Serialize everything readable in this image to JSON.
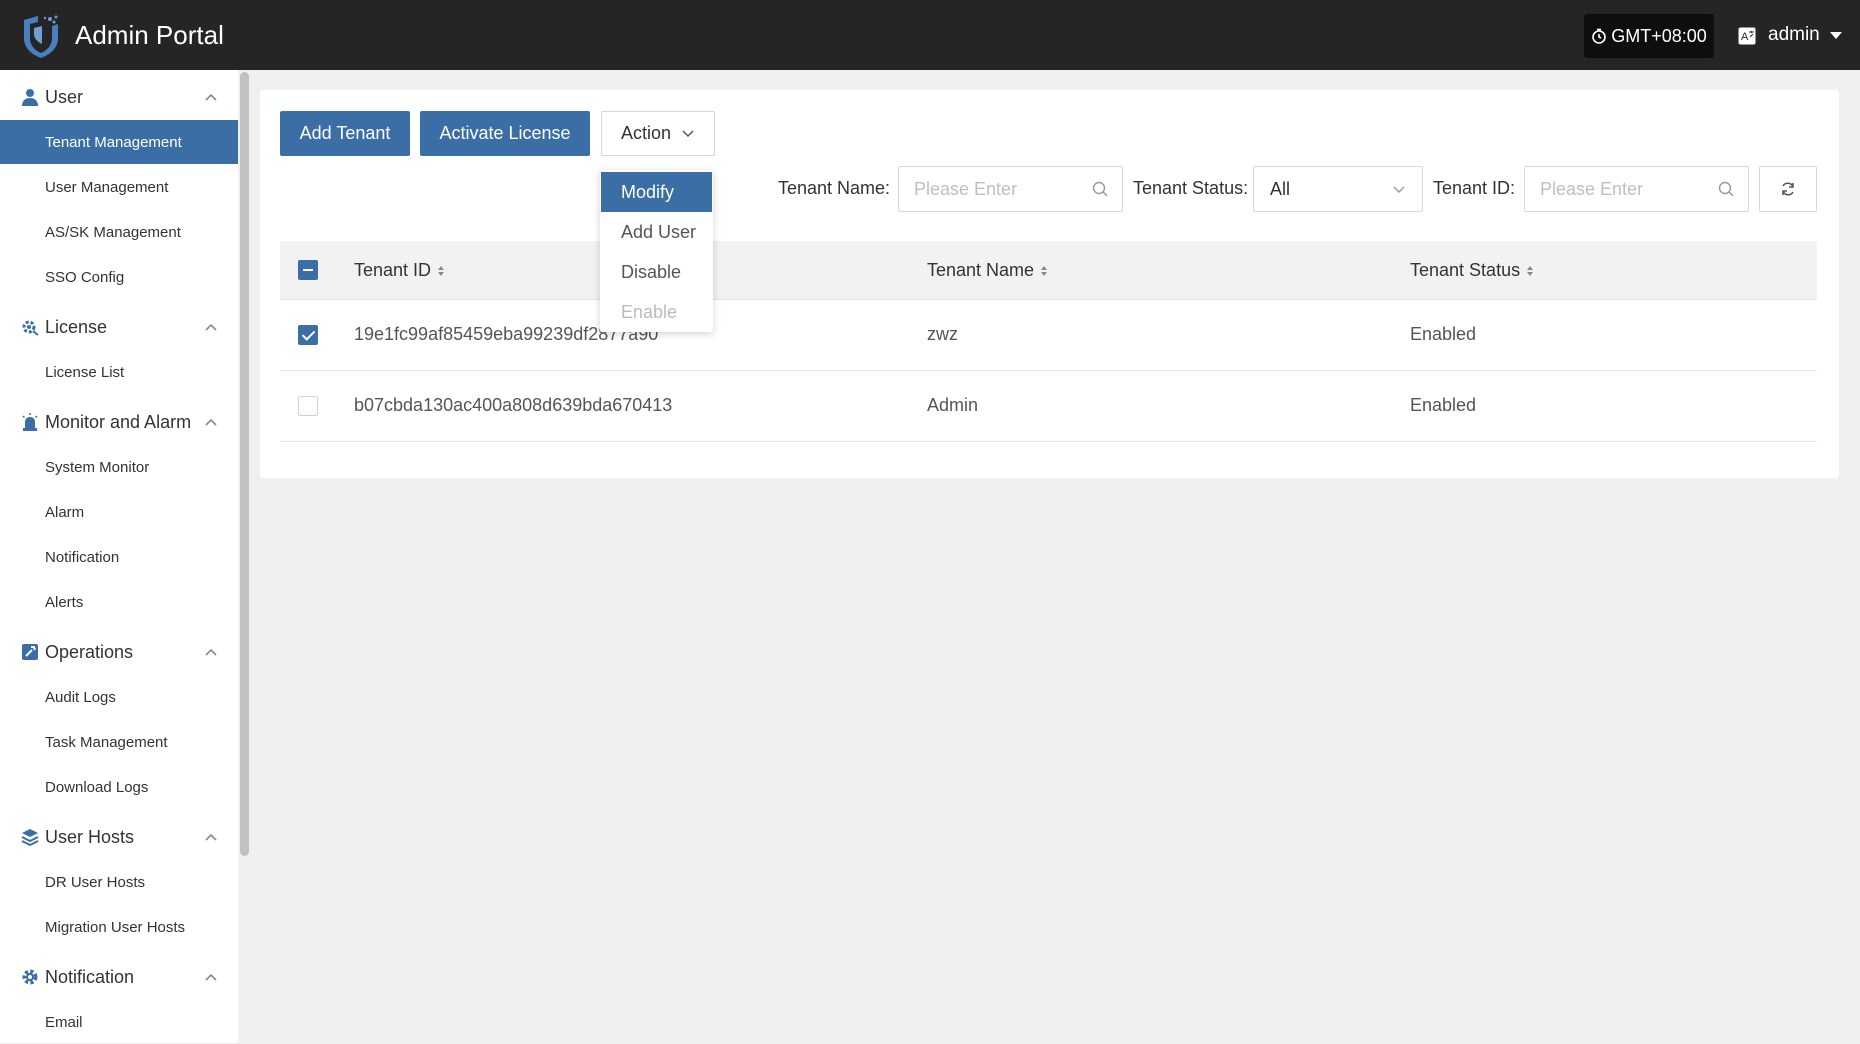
{
  "app": {
    "title": "Admin Portal"
  },
  "header": {
    "timezone": "GMT+08:00",
    "user": "admin"
  },
  "sidebar": {
    "groups": [
      {
        "label": "User",
        "icon": "user-icon",
        "items": [
          "Tenant Management",
          "User Management",
          "AS/SK Management",
          "SSO Config"
        ]
      },
      {
        "label": "License",
        "icon": "license-gear-icon",
        "items": [
          "License List"
        ]
      },
      {
        "label": "Monitor and Alarm",
        "icon": "alarm-siren-icon",
        "items": [
          "System Monitor",
          "Alarm",
          "Notification",
          "Alerts"
        ]
      },
      {
        "label": "Operations",
        "icon": "operations-wrench-icon",
        "items": [
          "Audit Logs",
          "Task Management",
          "Download Logs"
        ]
      },
      {
        "label": "User Hosts",
        "icon": "layers-icon",
        "items": [
          "DR User Hosts",
          "Migration User Hosts"
        ]
      },
      {
        "label": "Notification",
        "icon": "settings-gear-icon",
        "items": [
          "Email"
        ]
      }
    ],
    "active_item": "Tenant Management"
  },
  "toolbar": {
    "add_tenant": "Add Tenant",
    "activate_license": "Activate License",
    "action": "Action"
  },
  "action_menu": [
    {
      "label": "Modify",
      "state": "highlighted"
    },
    {
      "label": "Add User",
      "state": "normal"
    },
    {
      "label": "Disable",
      "state": "normal"
    },
    {
      "label": "Enable",
      "state": "disabled"
    }
  ],
  "filters": {
    "tenant_name_label": "Tenant Name:",
    "tenant_name_placeholder": "Please Enter",
    "tenant_status_label": "Tenant Status:",
    "tenant_status_value": "All",
    "tenant_id_label": "Tenant ID:",
    "tenant_id_placeholder": "Please Enter"
  },
  "table": {
    "columns": [
      "Tenant ID",
      "Tenant Name",
      "Tenant Status"
    ],
    "rows": [
      {
        "checked": true,
        "tenant_id": "19e1fc99af85459eba99239df2877a90",
        "tenant_name": "zwz",
        "tenant_status": "Enabled"
      },
      {
        "checked": false,
        "tenant_id": "b07cbda130ac400a808d639bda670413",
        "tenant_name": "Admin",
        "tenant_status": "Enabled"
      }
    ]
  },
  "colors": {
    "accent": "#3b6ea5",
    "topbar": "#252525"
  }
}
